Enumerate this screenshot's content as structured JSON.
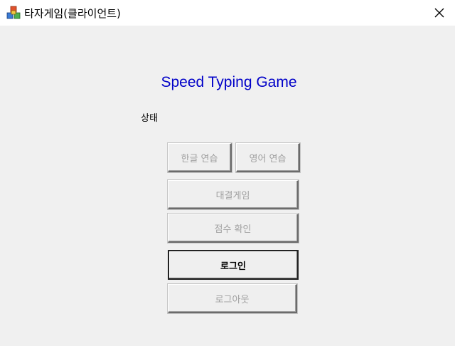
{
  "window": {
    "title": "타자게임(클라이언트)",
    "close_symbol": "✕"
  },
  "main": {
    "heading": "Speed Typing Game",
    "status": "상태",
    "buttons": {
      "korean_practice": "한글 연습",
      "english_practice": "영어 연습",
      "battle_game": "대결게임",
      "check_score": "점수 확인",
      "login": "로그인",
      "logout": "로그아웃"
    }
  },
  "colors": {
    "heading": "#0000c8",
    "disabled_text": "#a0a0a0",
    "background": "#f0f0f0"
  },
  "icons": {
    "app": "colored-cubes-icon",
    "close": "close-icon"
  }
}
